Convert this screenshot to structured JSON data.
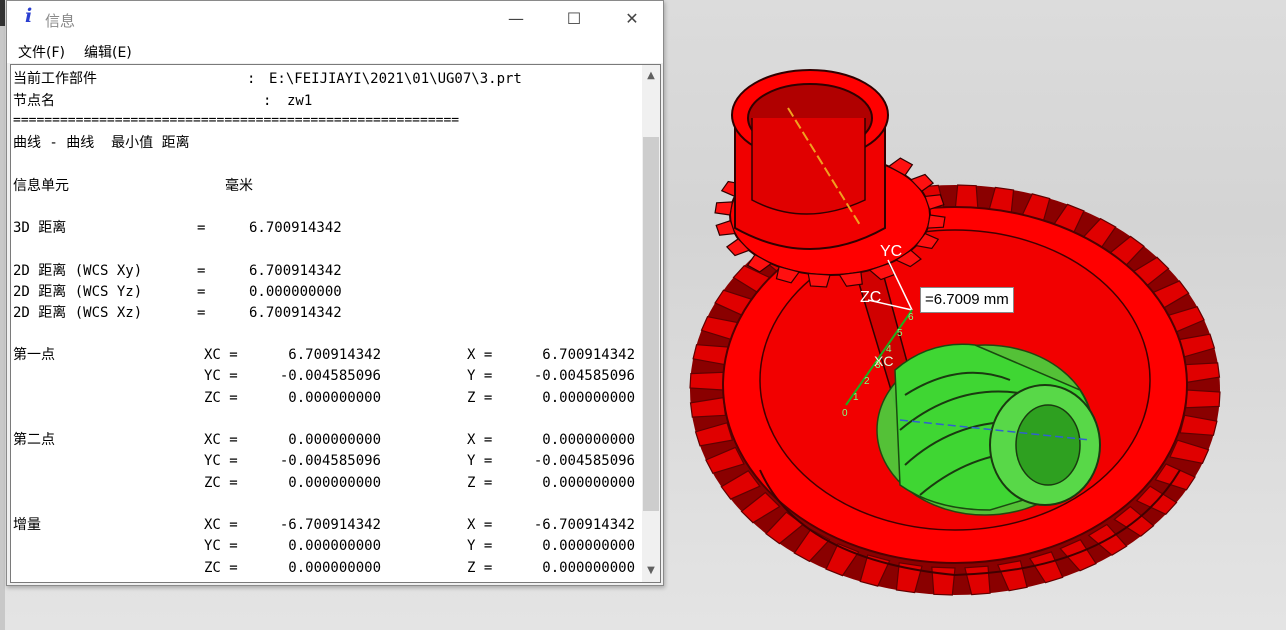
{
  "window": {
    "icon": "info-i-icon",
    "icon_glyph": "i",
    "title": "信息",
    "minimize_glyph": "—",
    "maximize_glyph": "☐",
    "close_glyph": "✕"
  },
  "menu": [
    {
      "label": "文件(F)"
    },
    {
      "label": "编辑(E)"
    }
  ],
  "info": {
    "work_part_label": "当前工作部件",
    "work_part_sep": ":",
    "work_part_value": "E:\\FEIJIAYI\\2021\\01\\UG07\\3.prt",
    "node_label": "节点名",
    "node_sep": ":",
    "node_value": "zw1",
    "separator": "=========================================================",
    "heading": "曲线 - 曲线  最小值 距离",
    "unit_label": "信息单元",
    "unit_value": "毫米",
    "dist3d_label": "3D 距离",
    "dist3d_eq": "=",
    "dist3d_value": "6.700914342",
    "d2_rows": [
      {
        "label": "2D 距离 (WCS Xy)",
        "eq": "=",
        "value": "6.700914342"
      },
      {
        "label": "2D 距离 (WCS Yz)",
        "eq": "=",
        "value": "0.000000000"
      },
      {
        "label": "2D 距离 (WCS Xz)",
        "eq": "=",
        "value": "6.700914342"
      }
    ],
    "point_groups": [
      {
        "label": "第一点",
        "rows": [
          {
            "wcs": "XC =",
            "wcs_value": "6.700914342",
            "abs": "X =",
            "abs_value": "6.700914342"
          },
          {
            "wcs": "YC =",
            "wcs_value": "-0.004585096",
            "abs": "Y =",
            "abs_value": "-0.004585096"
          },
          {
            "wcs": "ZC =",
            "wcs_value": "0.000000000",
            "abs": "Z =",
            "abs_value": "0.000000000"
          }
        ]
      },
      {
        "label": "第二点",
        "rows": [
          {
            "wcs": "XC =",
            "wcs_value": "0.000000000",
            "abs": "X =",
            "abs_value": "0.000000000"
          },
          {
            "wcs": "YC =",
            "wcs_value": "-0.004585096",
            "abs": "Y =",
            "abs_value": "-0.004585096"
          },
          {
            "wcs": "ZC =",
            "wcs_value": "0.000000000",
            "abs": "Z =",
            "abs_value": "0.000000000"
          }
        ]
      },
      {
        "label": "增量",
        "rows": [
          {
            "wcs": "XC =",
            "wcs_value": "-6.700914342",
            "abs": "X =",
            "abs_value": "-6.700914342"
          },
          {
            "wcs": "YC =",
            "wcs_value": "0.000000000",
            "abs": "Y =",
            "abs_value": "0.000000000"
          },
          {
            "wcs": "ZC =",
            "wcs_value": "0.000000000",
            "abs": "Z =",
            "abs_value": "0.000000000"
          }
        ]
      }
    ]
  },
  "scroll": {
    "up_glyph": "▲",
    "down_glyph": "▼"
  },
  "viewport": {
    "measurement_label": "=6.7009 mm",
    "axis_yc": "YC",
    "axis_zc": "ZC",
    "axis_xc": "XC",
    "ruler_ticks": [
      "0",
      "1",
      "2",
      "3",
      "4",
      "5",
      "6"
    ],
    "colors": {
      "gear_red": "#ff0000",
      "worm_green": "#33cc33",
      "axis_line": "#ffffff"
    }
  }
}
